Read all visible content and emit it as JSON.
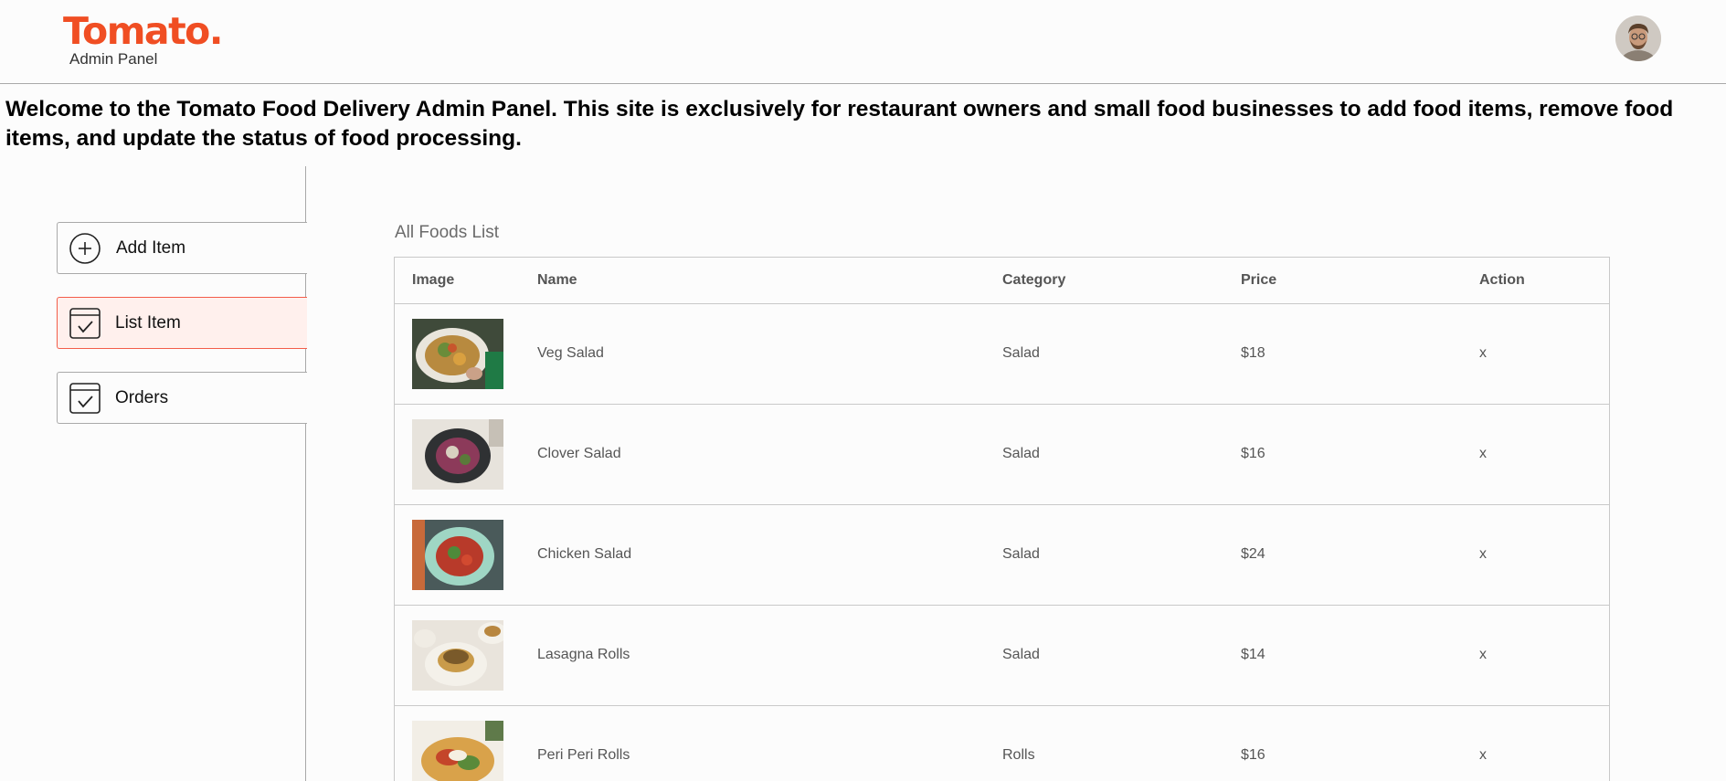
{
  "navbar": {
    "logo_text": "Tomato.",
    "logo_subtitle": "Admin Panel",
    "avatar_icon": "profile-avatar"
  },
  "welcome_text": "Welcome to the Tomato Food Delivery Admin Panel. This site is exclusively for restaurant owners and small food businesses to add food items, remove food items, and update the status of food processing.",
  "sidebar": {
    "items": [
      {
        "label": "Add Item",
        "icon": "add-circle-icon",
        "active": false
      },
      {
        "label": "List Item",
        "icon": "order-check-icon",
        "active": true
      },
      {
        "label": "Orders",
        "icon": "order-check-icon",
        "active": false
      }
    ]
  },
  "list": {
    "title": "All Foods List",
    "columns": [
      "Image",
      "Name",
      "Category",
      "Price",
      "Action"
    ],
    "rows": [
      {
        "name": "Veg Salad",
        "category": "Salad",
        "price": "$18",
        "action": "x"
      },
      {
        "name": "Clover Salad",
        "category": "Salad",
        "price": "$16",
        "action": "x"
      },
      {
        "name": "Chicken Salad",
        "category": "Salad",
        "price": "$24",
        "action": "x"
      },
      {
        "name": "Lasagna Rolls",
        "category": "Salad",
        "price": "$14",
        "action": "x"
      },
      {
        "name": "Peri Peri Rolls",
        "category": "Rolls",
        "price": "$16",
        "action": "x"
      }
    ]
  },
  "colors": {
    "brand": "#f04e23",
    "active_bg": "#fff0ed",
    "active_border": "#f35d4a",
    "border": "#a9a9a9"
  }
}
